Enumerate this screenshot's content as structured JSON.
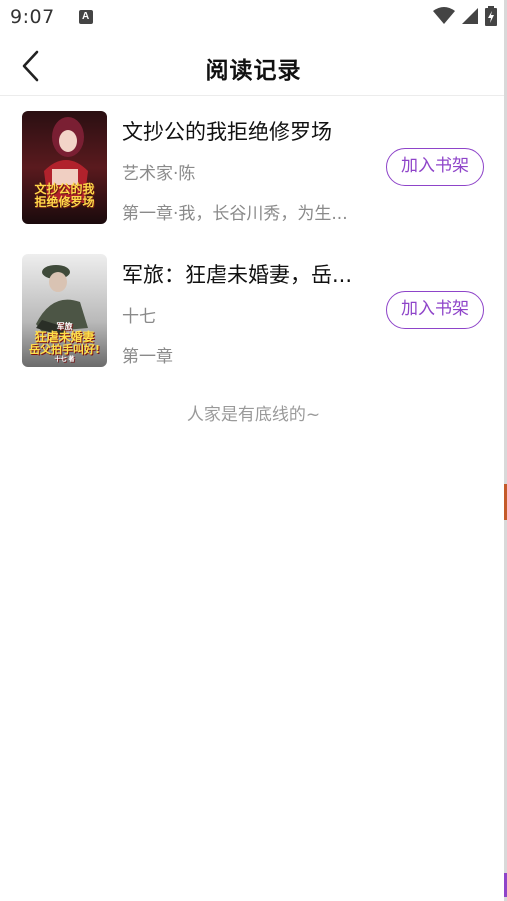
{
  "status_bar": {
    "time": "9:07",
    "notification_glyph": "A"
  },
  "header": {
    "title": "阅读记录"
  },
  "books": [
    {
      "title": "文抄公的我拒绝修罗场",
      "author": "艺术家·陈",
      "chapter": "第一章·我，长谷川秀，为生...",
      "add_label": "加入书架",
      "cover_text": [
        "文抄公的我",
        "拒绝修罗场"
      ]
    },
    {
      "title": "军旅：狂虐未婚妻，岳...",
      "author": "十七",
      "chapter": "第一章",
      "add_label": "加入书架",
      "cover_text": [
        "军旅",
        "狂虐未婚妻",
        "岳父拍手叫好!",
        "十七 著"
      ]
    }
  ],
  "footer_note": "人家是有底线的~",
  "colors": {
    "accent": "#8e44c9",
    "muted_text": "#8a8a8a"
  }
}
